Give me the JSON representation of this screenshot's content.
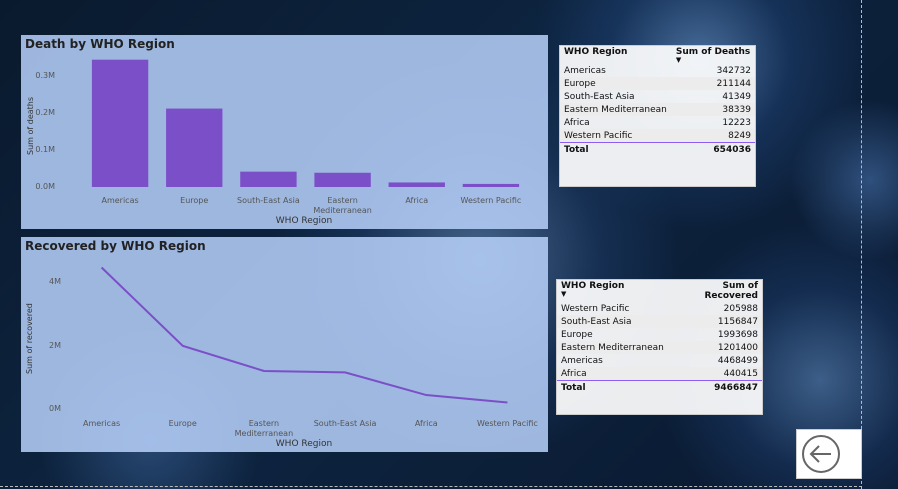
{
  "colors": {
    "accent": "#7b4fc8",
    "panel_bg": "#b7d0fa"
  },
  "icons": {
    "back": "back-arrow-icon"
  },
  "death_chart": {
    "title": "Death by WHO Region",
    "chart_data": {
      "type": "bar",
      "categories": [
        "Americas",
        "Europe",
        "South-East Asia",
        "Eastern Mediterranean",
        "Africa",
        "Western Pacific"
      ],
      "values": [
        342732,
        211144,
        41349,
        38339,
        12223,
        8249
      ],
      "ylabel": "Sum of deaths",
      "xlabel": "WHO Region",
      "ylim": [
        0,
        350000
      ],
      "yticks": [
        0,
        100000,
        200000,
        300000
      ],
      "ytick_labels": [
        "0.0M",
        "0.1M",
        "0.2M",
        "0.3M"
      ],
      "grid": false
    }
  },
  "recovered_chart": {
    "title": "Recovered by WHO Region",
    "chart_data": {
      "type": "line",
      "categories": [
        "Americas",
        "Europe",
        "Eastern Mediterranean",
        "South-East Asia",
        "Africa",
        "Western Pacific"
      ],
      "values": [
        4468499,
        1993698,
        1201400,
        1156847,
        440415,
        205988
      ],
      "ylabel": "Sum of recovered",
      "xlabel": "WHO Region",
      "ylim": [
        0,
        4800000
      ],
      "yticks": [
        0,
        2000000,
        4000000
      ],
      "ytick_labels": [
        "0M",
        "2M",
        "4M"
      ],
      "grid": false
    }
  },
  "deaths_table": {
    "headers": [
      "WHO Region",
      "Sum of Deaths"
    ],
    "rows": [
      [
        "Americas",
        "342732"
      ],
      [
        "Europe",
        "211144"
      ],
      [
        "South-East Asia",
        "41349"
      ],
      [
        "Eastern Mediterranean",
        "38339"
      ],
      [
        "Africa",
        "12223"
      ],
      [
        "Western Pacific",
        "8249"
      ]
    ],
    "total_label": "Total",
    "total_value": "654036"
  },
  "recovered_table": {
    "headers": [
      "WHO Region",
      "Sum of Recovered"
    ],
    "rows": [
      [
        "Western Pacific",
        "205988"
      ],
      [
        "South-East Asia",
        "1156847"
      ],
      [
        "Europe",
        "1993698"
      ],
      [
        "Eastern Mediterranean",
        "1201400"
      ],
      [
        "Americas",
        "4468499"
      ],
      [
        "Africa",
        "440415"
      ]
    ],
    "total_label": "Total",
    "total_value": "9466847"
  }
}
